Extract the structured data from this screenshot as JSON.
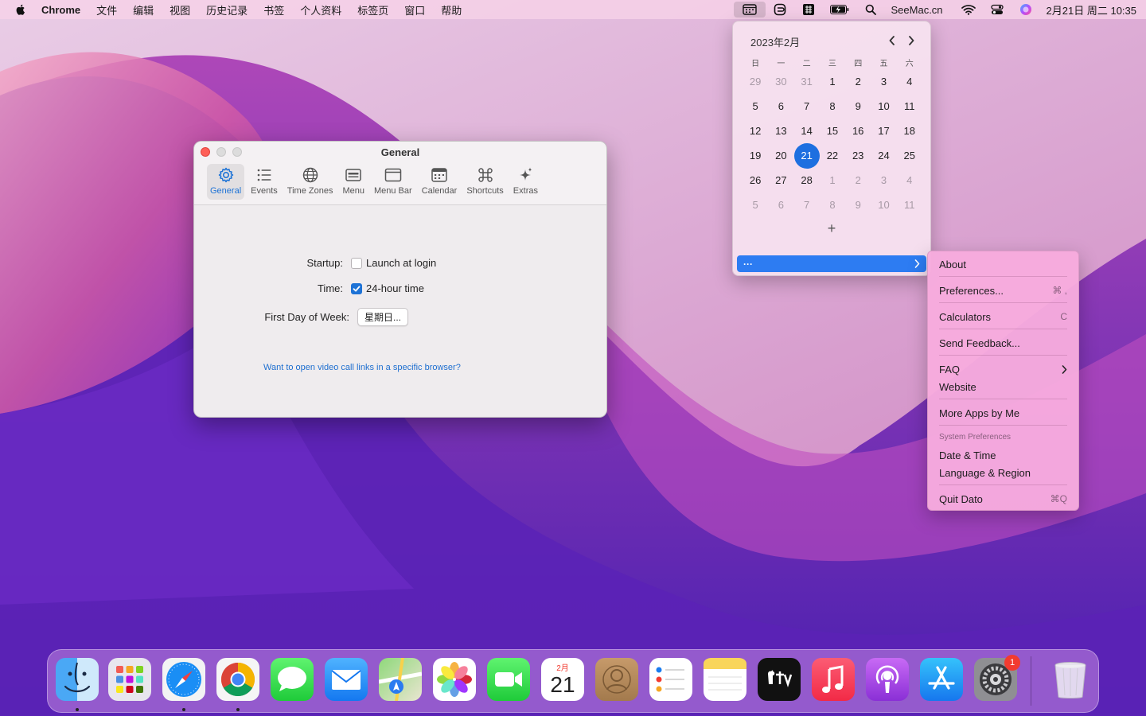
{
  "menubar": {
    "app": "Chrome",
    "menus": [
      "文件",
      "编辑",
      "视图",
      "历史记录",
      "书签",
      "个人资料",
      "标签页",
      "窗口",
      "帮助"
    ],
    "status_text": "SeeMac.cn",
    "clock": "2月21日 周二  10:35"
  },
  "window": {
    "title": "General",
    "tabs": [
      {
        "label": "General",
        "icon": "gear-icon"
      },
      {
        "label": "Events",
        "icon": "list-icon"
      },
      {
        "label": "Time Zones",
        "icon": "globe-icon"
      },
      {
        "label": "Menu",
        "icon": "menu-icon"
      },
      {
        "label": "Menu Bar",
        "icon": "menubar-icon"
      },
      {
        "label": "Calendar",
        "icon": "calendar-icon"
      },
      {
        "label": "Shortcuts",
        "icon": "command-icon"
      },
      {
        "label": "Extras",
        "icon": "sparkles-icon"
      }
    ],
    "startup_label": "Startup:",
    "startup_option": "Launch at login",
    "startup_checked": false,
    "time_label": "Time:",
    "time_option": "24-hour time",
    "time_checked": true,
    "first_day_label": "First Day of Week:",
    "first_day_value": "星期日...",
    "link_text": "Want to open video call links in a specific browser?"
  },
  "calendar": {
    "title": "2023年2月",
    "weekdays": [
      "日",
      "一",
      "二",
      "三",
      "四",
      "五",
      "六"
    ],
    "weeks": [
      [
        "29",
        "30",
        "31",
        "1",
        "2",
        "3",
        "4"
      ],
      [
        "5",
        "6",
        "7",
        "8",
        "9",
        "10",
        "11"
      ],
      [
        "12",
        "13",
        "14",
        "15",
        "16",
        "17",
        "18"
      ],
      [
        "19",
        "20",
        "21",
        "22",
        "23",
        "24",
        "25"
      ],
      [
        "26",
        "27",
        "28",
        "1",
        "2",
        "3",
        "4"
      ],
      [
        "5",
        "6",
        "7",
        "8",
        "9",
        "10",
        "11"
      ]
    ],
    "today": "21",
    "add_label": "+",
    "more_label": "···"
  },
  "context_menu": {
    "about": "About",
    "preferences": "Preferences...",
    "preferences_shortcut": "⌘ ,",
    "calculators": "Calculators",
    "calculators_shortcut": "C",
    "send_feedback": "Send Feedback...",
    "faq": "FAQ",
    "website": "Website",
    "more_apps": "More Apps by Me",
    "system_prefs_header": "System Preferences",
    "date_time": "Date & Time",
    "language_region": "Language & Region",
    "quit": "Quit Dato",
    "quit_shortcut": "⌘Q"
  },
  "dock": {
    "calendar_month": "2月",
    "calendar_day": "21",
    "settings_badge": "1",
    "apps": [
      "finder",
      "launchpad",
      "safari",
      "chrome",
      "messages",
      "mail",
      "maps",
      "photos",
      "facetime",
      "calendar",
      "contacts",
      "reminders",
      "notes",
      "tv",
      "music",
      "podcasts",
      "app-store",
      "system-preferences",
      "trash"
    ]
  }
}
